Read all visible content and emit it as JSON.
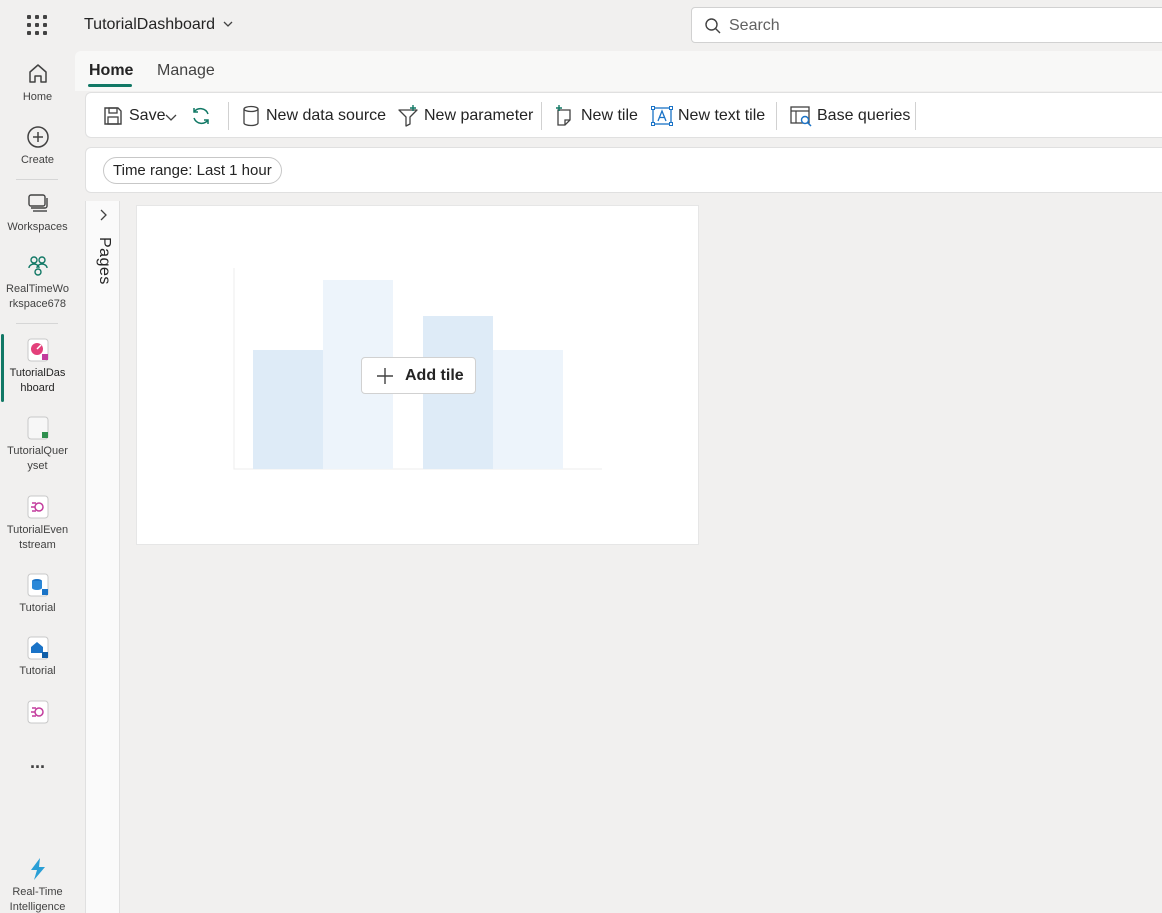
{
  "app": {
    "title": "TutorialDashboard"
  },
  "search": {
    "placeholder": "Search"
  },
  "rail": {
    "home": "Home",
    "create": "Create",
    "workspaces": "Workspaces",
    "workspace": "RealTimeWo rkspace678",
    "dashboard": "TutorialDas hboard",
    "queryset": "TutorialQuer yset",
    "eventstream": "TutorialEven tstream",
    "tutorial1": "Tutorial",
    "tutorial2": "Tutorial",
    "more": "...",
    "rti": "Real-Time Intelligence"
  },
  "tabs": [
    {
      "label": "Home",
      "active": true
    },
    {
      "label": "Manage",
      "active": false
    }
  ],
  "toolbar": {
    "save": "Save",
    "new_data_source": "New data source",
    "new_parameter": "New parameter",
    "new_tile": "New tile",
    "new_text_tile": "New text tile",
    "base_queries": "Base queries"
  },
  "filter": {
    "time_range_label": "Time range:",
    "time_range_value": "Last 1 hour"
  },
  "pages": {
    "label": "Pages"
  },
  "canvas": {
    "add_tile": "Add tile"
  },
  "colors": {
    "accent": "#117865",
    "bar_dark": "#deebf7",
    "bar_light": "#edf4fb"
  },
  "icons": [
    "waffle-icon",
    "chevron-down-icon",
    "search-icon",
    "home-icon",
    "create-icon",
    "workspaces-icon",
    "workspace-icon",
    "dashboard-icon",
    "queryset-icon",
    "eventstream-icon",
    "eventhouse-icon",
    "database-icon",
    "more-icon",
    "real-time-intelligence-icon",
    "save-icon",
    "refresh-icon",
    "data-source-icon",
    "parameter-icon",
    "new-tile-icon",
    "text-tile-icon",
    "base-queries-icon",
    "chevron-right-icon",
    "add-icon"
  ]
}
